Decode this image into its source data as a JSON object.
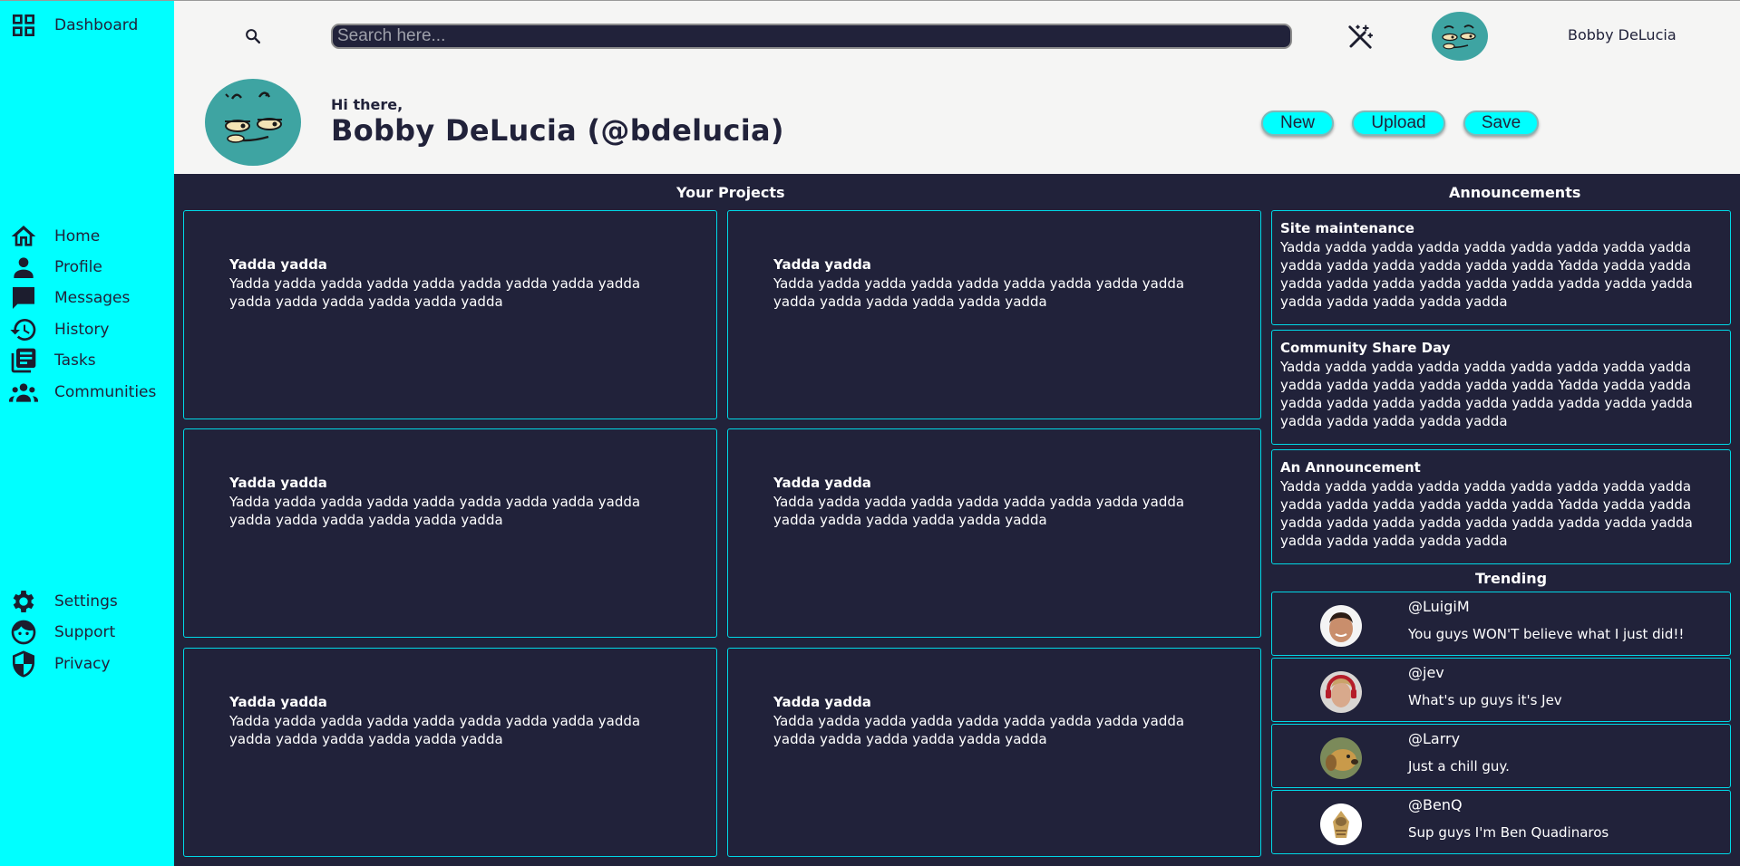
{
  "sidebar": {
    "dashboard": "Dashboard",
    "nav": [
      "Home",
      "Profile",
      "Messages",
      "History",
      "Tasks",
      "Communities"
    ],
    "footer": [
      "Settings",
      "Support",
      "Privacy"
    ],
    "accent": "#00ffff"
  },
  "header": {
    "search_placeholder": "Search here...",
    "username": "Bobby DeLucia",
    "greeting": "Hi there,",
    "full_name": "Bobby DeLucia (@bdelucia)",
    "buttons": {
      "new": "New",
      "upload": "Upload",
      "save": "Save"
    }
  },
  "projects": {
    "title": "Your Projects",
    "items": [
      {
        "title": "Yadda yadda",
        "body": "Yadda yadda yadda yadda yadda yadda yadda yadda yadda yadda yadda yadda yadda yadda yadda"
      },
      {
        "title": "Yadda yadda",
        "body": "Yadda yadda yadda yadda yadda yadda yadda yadda yadda yadda yadda yadda yadda yadda yadda"
      },
      {
        "title": "Yadda yadda",
        "body": "Yadda yadda yadda yadda yadda yadda yadda yadda yadda yadda yadda yadda yadda yadda yadda"
      },
      {
        "title": "Yadda yadda",
        "body": "Yadda yadda yadda yadda yadda yadda yadda yadda yadda yadda yadda yadda yadda yadda yadda"
      },
      {
        "title": "Yadda yadda",
        "body": "Yadda yadda yadda yadda yadda yadda yadda yadda yadda yadda yadda yadda yadda yadda yadda"
      },
      {
        "title": "Yadda yadda",
        "body": "Yadda yadda yadda yadda yadda yadda yadda yadda yadda yadda yadda yadda yadda yadda yadda"
      }
    ]
  },
  "announcements": {
    "title": "Announcements",
    "items": [
      {
        "title": "Site maintenance",
        "body": "Yadda yadda yadda yadda yadda yadda yadda yadda yadda yadda yadda yadda yadda yadda yadda Yadda yadda yadda yadda yadda yadda yadda yadda yadda yadda yadda yadda yadda yadda yadda yadda yadda"
      },
      {
        "title": "Community Share Day",
        "body": "Yadda yadda yadda yadda yadda yadda yadda yadda yadda yadda yadda yadda yadda yadda yadda Yadda yadda yadda yadda yadda yadda yadda yadda yadda yadda yadda yadda yadda yadda yadda yadda yadda"
      },
      {
        "title": "An Announcement",
        "body": "Yadda yadda yadda yadda yadda yadda yadda yadda yadda yadda yadda yadda yadda yadda yadda Yadda yadda yadda yadda yadda yadda yadda yadda yadda yadda yadda yadda yadda yadda yadda yadda yadda"
      }
    ]
  },
  "trending": {
    "title": "Trending",
    "items": [
      {
        "handle": "@LuigiM",
        "message": "You guys WON'T believe what I just did!!"
      },
      {
        "handle": "@jev",
        "message": "What's up guys it's Jev"
      },
      {
        "handle": "@Larry",
        "message": "Just a chill guy."
      },
      {
        "handle": "@BenQ",
        "message": "Sup guys I'm Ben Quadinaros"
      }
    ]
  }
}
